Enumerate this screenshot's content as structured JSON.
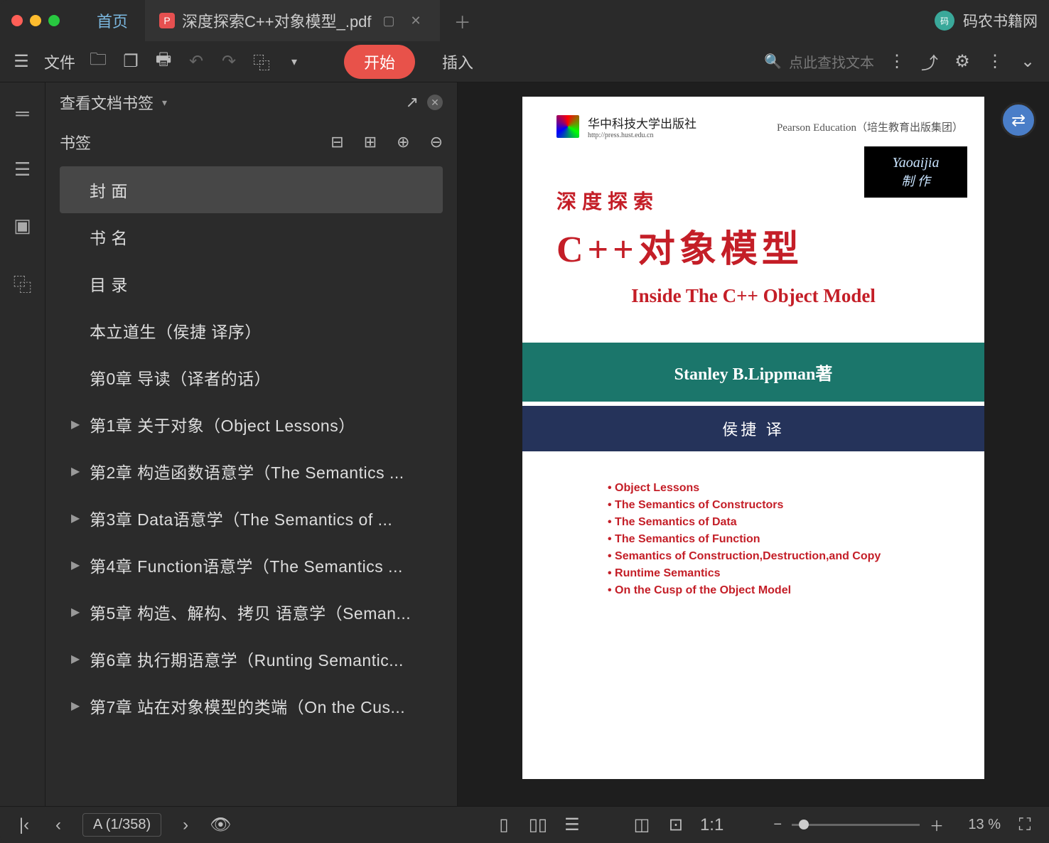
{
  "titlebar": {
    "home_tab": "首页",
    "file_tab": "深度探索C++对象模型_.pdf",
    "user_name": "码农书籍网"
  },
  "toolbar": {
    "file_label": "文件",
    "start_label": "开始",
    "insert_label": "插入",
    "search_placeholder": "点此查找文本"
  },
  "sidebar": {
    "header": "查看文档书签",
    "section_label": "书签",
    "bookmarks": [
      {
        "label": "封 面",
        "has_children": false,
        "selected": true
      },
      {
        "label": "书 名",
        "has_children": false
      },
      {
        "label": "目 录",
        "has_children": false
      },
      {
        "label": "本立道生（侯捷 译序）",
        "has_children": false
      },
      {
        "label": "第0章 导读（译者的话）",
        "has_children": false
      },
      {
        "label": "第1章 关于对象（Object Lessons）",
        "has_children": true
      },
      {
        "label": "第2章 构造函数语意学（The Semantics ...",
        "has_children": true
      },
      {
        "label": "第3章 Data语意学（The Semantics of ...",
        "has_children": true
      },
      {
        "label": "第4章 Function语意学（The Semantics ...",
        "has_children": true
      },
      {
        "label": "第5章 构造、解构、拷贝 语意学（Seman...",
        "has_children": true
      },
      {
        "label": "第6章 执行期语意学（Runting Semantic...",
        "has_children": true
      },
      {
        "label": "第7章 站在对象模型的类端（On the Cus...",
        "has_children": true
      }
    ]
  },
  "page": {
    "publisher_cn": "华中科技大学出版社",
    "publisher_url": "http://press.hust.edu.cn",
    "pearson": "Pearson Education（培生教育出版集团）",
    "badge_line1": "Yaoaijia",
    "badge_line2": "制 作",
    "title_cn_1": "深度探索",
    "title_cn_2": "C++对象模型",
    "title_en": "Inside The C++ Object Model",
    "author": "Stanley B.Lippman著",
    "translator": "侯捷 译",
    "topics": [
      "Object Lessons",
      "The Semantics of Constructors",
      "The Semantics of Data",
      "The Semantics of Function",
      "Semantics of Construction,Destruction,and Copy",
      "Runtime Semantics",
      "On the Cusp of the Object Model"
    ]
  },
  "statusbar": {
    "page_indicator": "A (1/358)",
    "zoom_label": "13 %"
  }
}
